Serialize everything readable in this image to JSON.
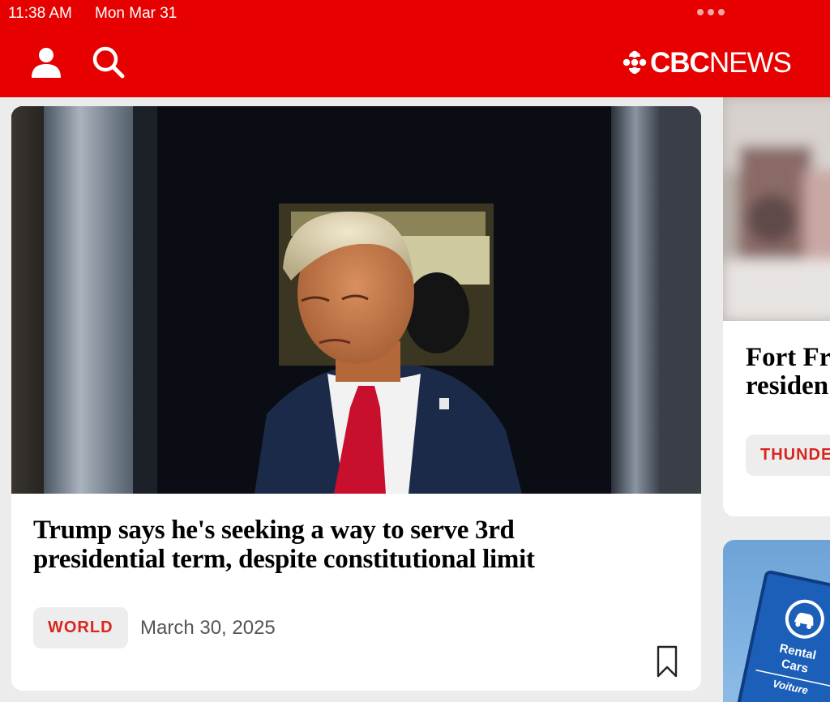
{
  "status_bar": {
    "time": "11:38 AM",
    "date": "Mon Mar 31"
  },
  "header": {
    "logo_text_bold": "CBC",
    "logo_text_light": "NEWS",
    "brand_color": "#e60000",
    "icons": [
      "user-icon",
      "search-icon",
      "cbc-gem-icon"
    ]
  },
  "main_story": {
    "headline": "Trump says he's seeking a way to serve 3rd presidential term, despite constitutional limit",
    "category": "WORLD",
    "date": "March 30, 2025",
    "category_color": "#d7261e"
  },
  "side_story": {
    "headline_line1": "Fort Fra",
    "headline_line2": "residen",
    "category": "THUNDE"
  },
  "side_story_2": {
    "sign_text_1": "Rental",
    "sign_text_2": "Cars",
    "sign_text_3": "Voiture"
  }
}
